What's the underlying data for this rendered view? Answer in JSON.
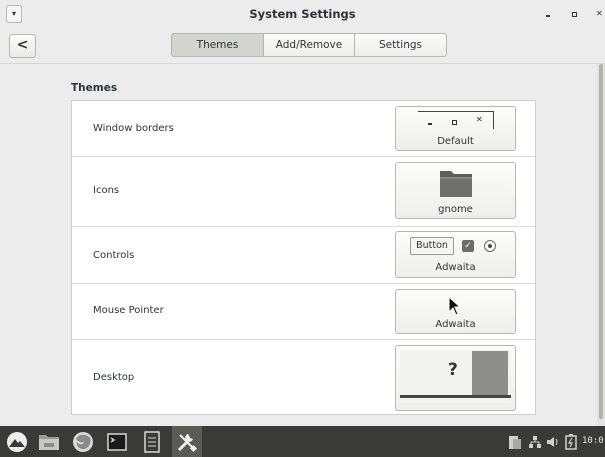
{
  "window": {
    "title": "System Settings",
    "menu_glyph": "▾",
    "close_glyph": "✕"
  },
  "header": {
    "back_glyph": "<",
    "tabs": [
      {
        "label": "Themes",
        "active": true
      },
      {
        "label": "Add/Remove",
        "active": false
      },
      {
        "label": "Settings",
        "active": false
      }
    ]
  },
  "themes": {
    "section_title": "Themes",
    "rows": [
      {
        "label": "Window borders",
        "value": "Default",
        "preview": "window-controls-icon"
      },
      {
        "label": "Icons",
        "value": "gnome",
        "preview": "folder-icon"
      },
      {
        "label": "Controls",
        "value": "Adwaita",
        "preview": "controls-preview",
        "preview_button": "Button"
      },
      {
        "label": "Mouse Pointer",
        "value": "Adwaita",
        "preview": "cursor-arrow-icon"
      },
      {
        "label": "Desktop",
        "value": "",
        "preview": "desktop-wallpaper-preview",
        "preview_symbol": "?"
      }
    ]
  },
  "taskbar": {
    "clock": "10:0",
    "apps": [
      "menu-logo-icon",
      "file-manager-icon",
      "firefox-icon",
      "terminal-icon",
      "text-editor-icon",
      "system-settings-icon"
    ],
    "tray": [
      "clipboard-icon",
      "network-icon",
      "volume-icon",
      "battery-icon"
    ]
  },
  "colors": {
    "taskbar_bg": "#3a3a38",
    "active_tab_bg": "#d3d3d0",
    "list_bg": "#ffffff"
  }
}
